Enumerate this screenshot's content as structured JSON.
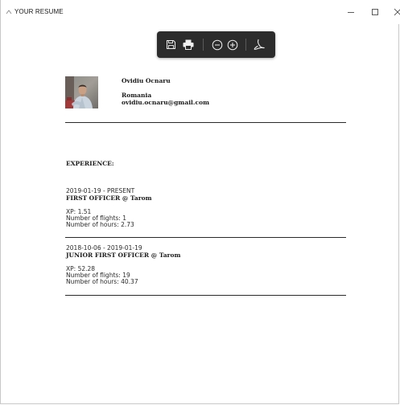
{
  "window": {
    "title": "YOUR RESUME"
  },
  "toolbar": {
    "buttons": [
      "save-icon",
      "print-icon",
      "zoom-out-icon",
      "zoom-in-icon",
      "pdf-icon"
    ]
  },
  "profile": {
    "name": "Ovidiu Ocnaru",
    "country": "Romania",
    "email": "ovidiu.ocnaru@gmail.com"
  },
  "experience": {
    "heading": "EXPERIENCE:",
    "entries": [
      {
        "dates": "2019-01-19 - PRESENT",
        "role": "FIRST OFFICER @ Tarom",
        "xp": "XP: 1.51",
        "flights": "Number of flights: 1",
        "hours": "Number of hours: 2.73"
      },
      {
        "dates": "2018-10-06 - 2019-01-19",
        "role": "JUNIOR FIRST OFFICER @ Tarom",
        "xp": "XP: 52.28",
        "flights": "Number of flights: 19",
        "hours": "Number of hours: 40.37"
      }
    ]
  },
  "colors": {
    "toolbar_bg": "#2c2c2c",
    "text": "#1c1c1c",
    "rule": "#2a2a2a"
  }
}
